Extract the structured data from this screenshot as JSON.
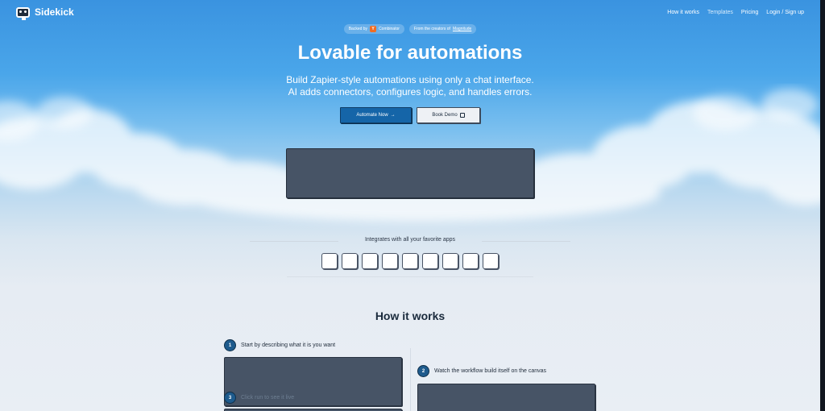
{
  "nav": {
    "brand": "Sidekick",
    "links": [
      "How it works",
      "Templates",
      "Pricing",
      "Login / Sign up"
    ]
  },
  "badges": {
    "backed_prefix": "Backed by",
    "yc_letter": "Y",
    "backed_name": "Combinator",
    "creators_prefix": "From the creators of",
    "creators_name": "Magnitude"
  },
  "hero": {
    "title": "Lovable for automations",
    "subtitle_line1": "Build Zapier-style automations using only a chat interface.",
    "subtitle_line2": "AI adds connectors, configures logic, and handles errors."
  },
  "cta": {
    "primary_label": "Automate Now",
    "primary_arrow": "→",
    "secondary_label": "Book Demo"
  },
  "integrations": {
    "title": "Integrates with all your favorite apps",
    "tile_count": 9
  },
  "how": {
    "title": "How it works",
    "steps": [
      {
        "num": "1",
        "label": "Start by describing what it is you want"
      },
      {
        "num": "2",
        "label": "Watch the workflow build itself on the canvas"
      },
      {
        "num": "3",
        "label": "Click run to see it live"
      }
    ]
  },
  "colors": {
    "primary": "#1565a8",
    "placeholder": "#475466",
    "step_badge": "#1e5b8d"
  }
}
